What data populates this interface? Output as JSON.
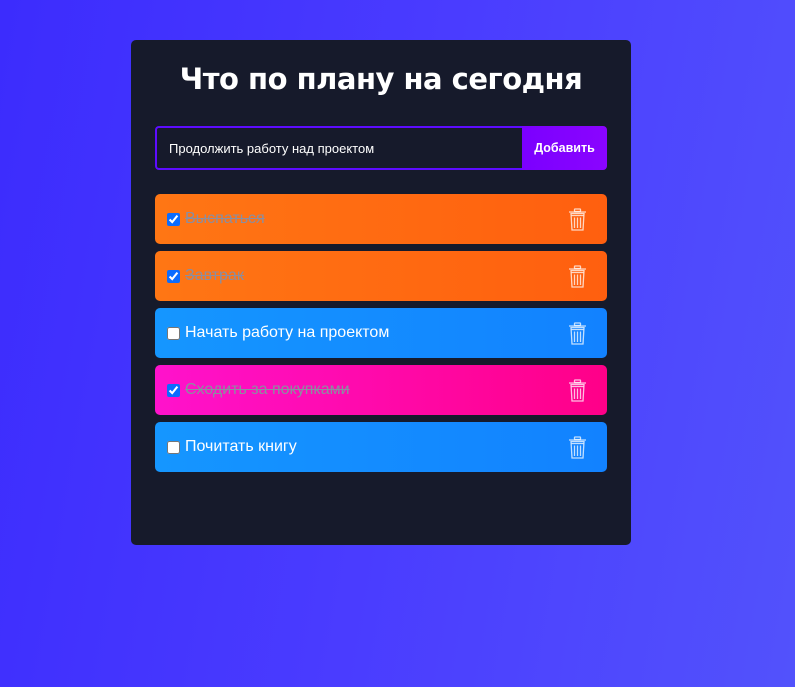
{
  "header": {
    "title": "Что по плану на сегодня"
  },
  "form": {
    "input_value": "Продолжить работу над проектом",
    "add_label": "Добавить"
  },
  "todos": [
    {
      "text": "Выспаться",
      "done": true,
      "color": "orange"
    },
    {
      "text": "Завтрак",
      "done": true,
      "color": "orange"
    },
    {
      "text": "Начать работу на проектом",
      "done": false,
      "color": "blue"
    },
    {
      "text": "Сходить за покупками",
      "done": true,
      "color": "pink"
    },
    {
      "text": "Почитать книгу",
      "done": false,
      "color": "blue"
    }
  ],
  "icons": {
    "delete": "trash-icon"
  },
  "colors": {
    "card": "#161a2b",
    "accent": "#5d0cff",
    "button": "#8a04ff",
    "orange": "#ff6a11",
    "blue": "#148cff",
    "pink": "#ff0ab0"
  }
}
